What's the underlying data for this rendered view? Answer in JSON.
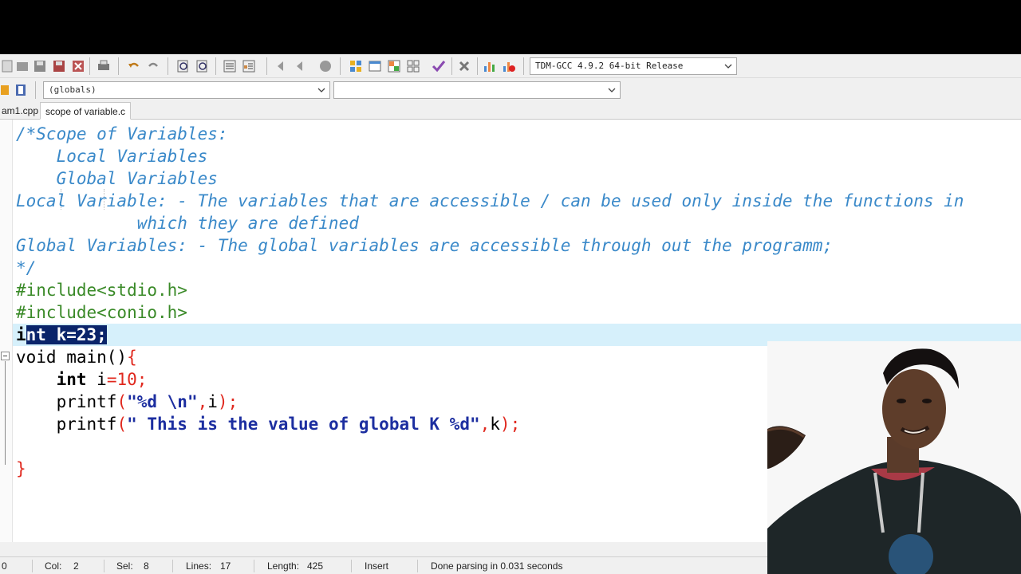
{
  "toolbar": {
    "compiler": "TDM-GCC 4.9.2 64-bit Release"
  },
  "toolbar2": {
    "scope": "(globals)",
    "function": ""
  },
  "tabs": [
    {
      "label": "am1.cpp",
      "active": false
    },
    {
      "label": "scope of variable.c",
      "active": true
    }
  ],
  "code": {
    "l1": "/*Scope of Variables:",
    "l2": "    Local Variables",
    "l3": "    Global Variables",
    "l4": "Local Variable: - The variables that are accessible / can be used only inside the functions in",
    "l5": "            which they are defined",
    "l6": "Global Variables: - The global variables are accessible through out the programm;",
    "l7": "*/",
    "l8": "#include<stdio.h>",
    "l9": "#include<conio.h>",
    "l10_a": "i",
    "l10_b": "nt k=23;",
    "l11_kw": "void",
    "l11_rest": " main()",
    "l11_brace": "{",
    "l12_kw": "    int",
    "l12_id": " i",
    "l12_eq": "=",
    "l12_num": "10",
    "l12_semi": ";",
    "l13_fn": "    printf",
    "l13_p1": "(",
    "l13_str": "\"%d \\n\"",
    "l13_c": ",",
    "l13_id": "i",
    "l13_p2": ");",
    "l14_fn": "    printf",
    "l14_p1": "(",
    "l14_str": "\" This is the value of global K %d\"",
    "l14_c": ",",
    "l14_id": "k",
    "l14_p2": ");",
    "l16": "}"
  },
  "status": {
    "line_prefix": "0",
    "col_label": "Col:",
    "col_value": "2",
    "sel_label": "Sel:",
    "sel_value": "8",
    "lines_label": "Lines:",
    "lines_value": "17",
    "length_label": "Length:",
    "length_value": "425",
    "mode": "Insert",
    "message": "Done parsing in 0.031 seconds"
  },
  "colors": {
    "comment": "#3a89c9",
    "preprocessor": "#3a8a28",
    "string": "#1c2ea0",
    "symbol": "#e0281e",
    "selection": "#0a246a",
    "current_line": "#d6f0fb"
  }
}
